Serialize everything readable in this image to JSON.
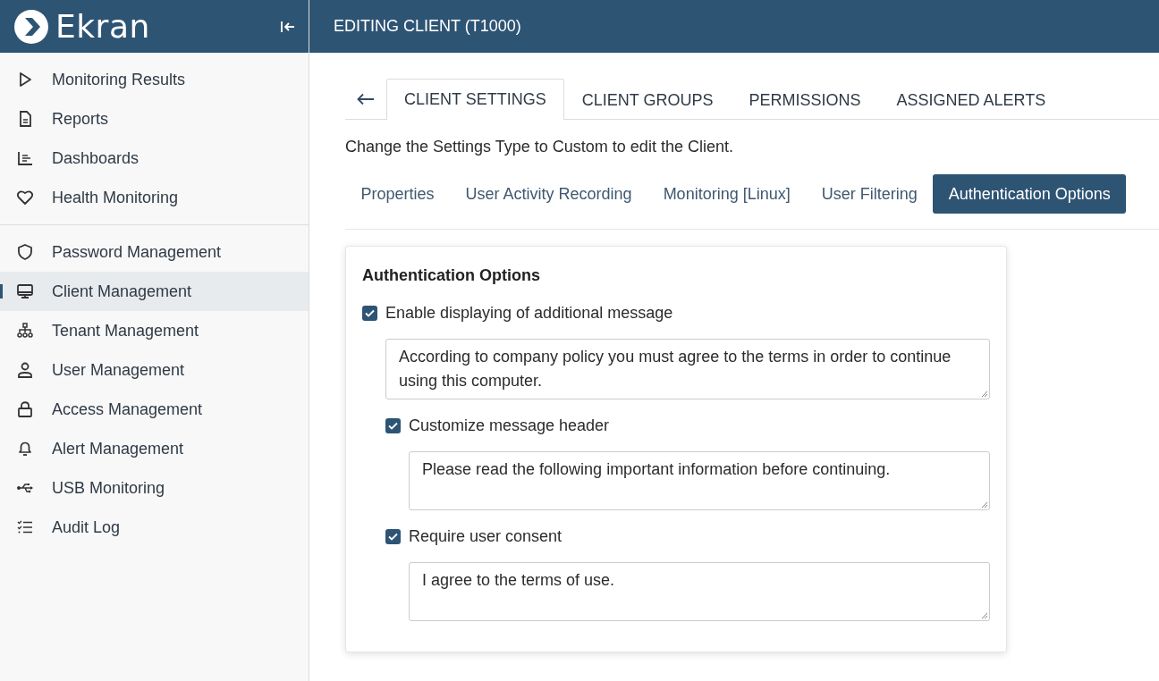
{
  "sidebar": {
    "logo": "Ekran",
    "groups": [
      {
        "items": [
          {
            "label": "Monitoring Results",
            "kind": "play",
            "selected": false
          },
          {
            "label": "Reports",
            "kind": "document",
            "selected": false
          },
          {
            "label": "Dashboards",
            "kind": "chart",
            "selected": false
          },
          {
            "label": "Health Monitoring",
            "kind": "heart",
            "selected": false
          }
        ]
      },
      {
        "items": [
          {
            "label": "Password Management",
            "kind": "shield",
            "selected": false
          },
          {
            "label": "Client Management",
            "kind": "monitor",
            "selected": true
          },
          {
            "label": "Tenant Management",
            "kind": "hierarchy",
            "selected": false
          },
          {
            "label": "User Management",
            "kind": "user",
            "selected": false
          },
          {
            "label": "Access Management",
            "kind": "lock",
            "selected": false
          },
          {
            "label": "Alert Management",
            "kind": "bell",
            "selected": false
          },
          {
            "label": "USB Monitoring",
            "kind": "usb",
            "selected": false
          },
          {
            "label": "Audit Log",
            "kind": "checklist",
            "selected": false
          }
        ]
      }
    ]
  },
  "header": {
    "title": "EDITING CLIENT (T1000)"
  },
  "tabs": [
    {
      "label": "CLIENT SETTINGS",
      "selected": true
    },
    {
      "label": "CLIENT GROUPS",
      "selected": false
    },
    {
      "label": "PERMISSIONS",
      "selected": false
    },
    {
      "label": "ASSIGNED ALERTS",
      "selected": false
    }
  ],
  "notice": "Change the Settings Type to Custom to edit the Client.",
  "subtabs": [
    {
      "label": "Properties",
      "selected": false
    },
    {
      "label": "User Activity Recording",
      "selected": false
    },
    {
      "label": "Monitoring [Linux]",
      "selected": false
    },
    {
      "label": "User Filtering",
      "selected": false
    },
    {
      "label": "Authentication Options",
      "selected": true
    }
  ],
  "card": {
    "title": "Authentication Options",
    "options": [
      {
        "label": "Enable displaying of additional message",
        "checked": true,
        "message": "According to company policy you must agree to the terms in order to continue using this computer.",
        "children": [
          {
            "label": "Customize message header",
            "checked": true,
            "message": "Please read the following important information before continuing."
          },
          {
            "label": "Require user consent",
            "checked": true,
            "message": "I agree to the terms of use."
          }
        ]
      }
    ]
  }
}
